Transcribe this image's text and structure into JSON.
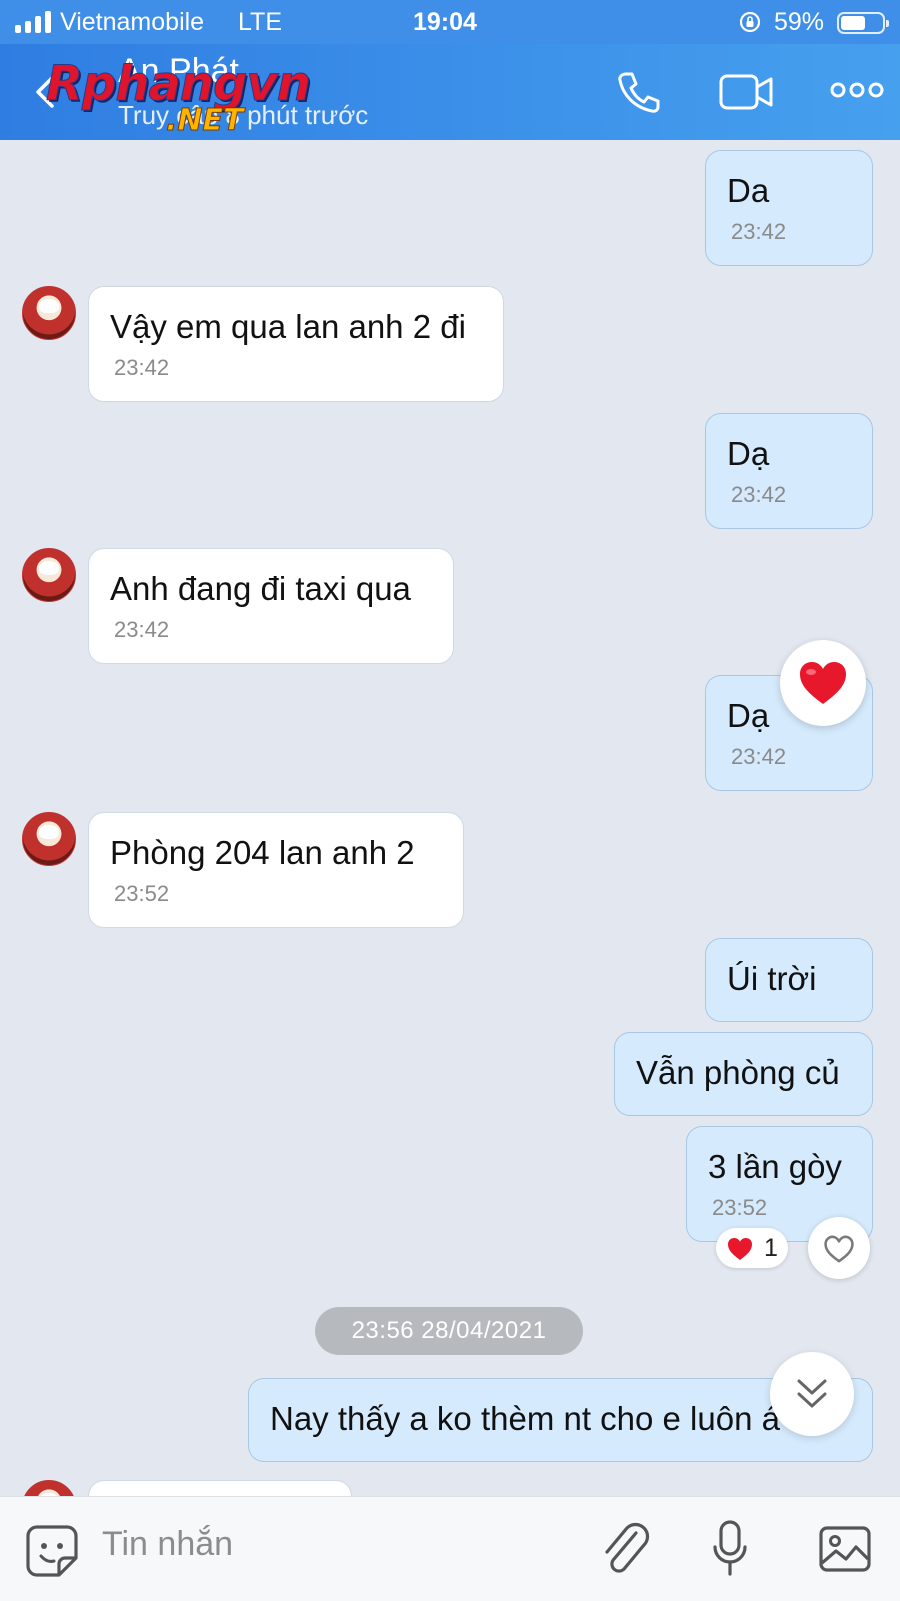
{
  "status_bar": {
    "carrier": "Vietnamobile",
    "network": "LTE",
    "time": "19:04",
    "battery_percent": "59%",
    "battery_level": 0.59
  },
  "header": {
    "contact_name": "An Phát",
    "last_seen": "Truy cập 8 phút trước",
    "watermark_text": "Rphangvn",
    "watermark_suffix": ".NET",
    "icons": [
      "back-arrow-icon",
      "phone-icon",
      "video-call-icon",
      "more-icon"
    ]
  },
  "messages": [
    {
      "dir": "out",
      "text": "Da",
      "time": "23:42"
    },
    {
      "dir": "in",
      "text": "Vậy em qua lan anh 2 đi",
      "time": "23:42"
    },
    {
      "dir": "out",
      "text": "Dạ",
      "time": "23:42"
    },
    {
      "dir": "in",
      "text": "Anh đang đi taxi qua",
      "time": "23:42"
    },
    {
      "dir": "out",
      "text": "Dạ",
      "time": "23:42",
      "reaction": "heart"
    },
    {
      "dir": "in",
      "text": "Phòng  204 lan anh 2",
      "time": "23:52"
    },
    {
      "dir": "out",
      "text": "Úi trời"
    },
    {
      "dir": "out",
      "text": "Vẫn phòng củ"
    },
    {
      "dir": "out",
      "text": "3 lần gòy",
      "time": "23:52",
      "reaction_count": "1"
    },
    {
      "dir": "out",
      "text": "Nay thấy a ko thèm nt cho e luôn á"
    }
  ],
  "date_separator": "23:56 28/04/2021",
  "composer": {
    "placeholder": "Tin nhắn",
    "icons": [
      "sticker-icon",
      "attachment-icon",
      "microphone-icon",
      "image-icon"
    ]
  },
  "colors": {
    "header": "#3f8ee8",
    "chat_background": "#e3e8f0",
    "outgoing_bubble": "#d5eafd",
    "incoming_bubble": "#ffffff",
    "heart": "#e8182c"
  }
}
